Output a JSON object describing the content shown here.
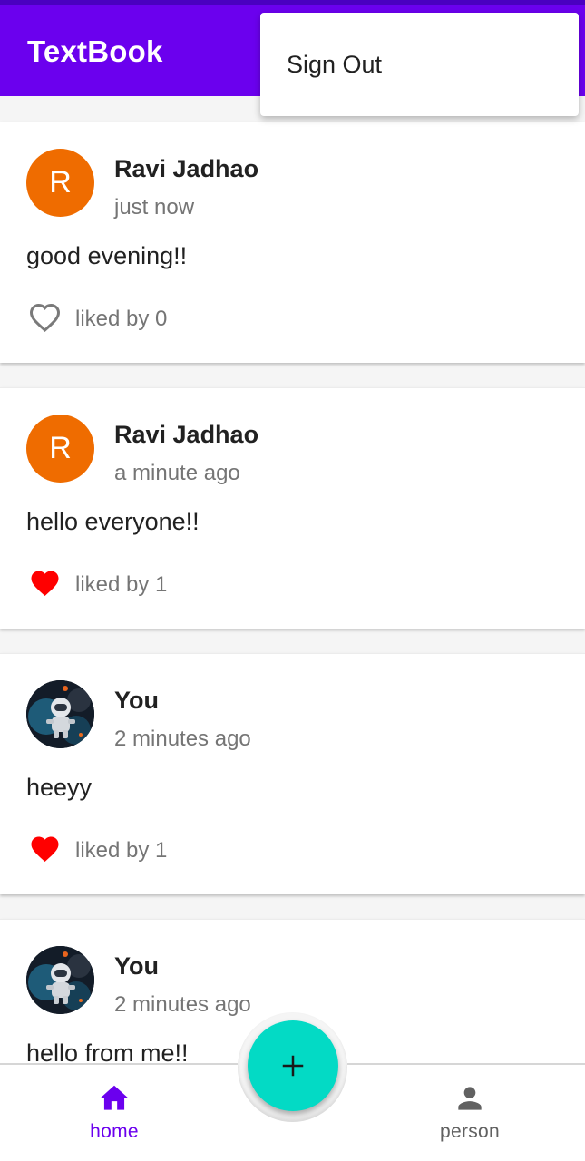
{
  "app_bar": {
    "title": "TextBook",
    "background": "#6b00ee"
  },
  "overflow_menu": {
    "items": [
      {
        "label": "Sign Out"
      }
    ]
  },
  "posts": [
    {
      "author": "Ravi Jadhao",
      "avatar_type": "letter",
      "avatar_letter": "R",
      "avatar_color": "#ef6c00",
      "time": "just now",
      "text": "good evening!!",
      "liked": false,
      "like_icon": "heart-outline-icon",
      "likes_label": "liked by 0"
    },
    {
      "author": "Ravi Jadhao",
      "avatar_type": "letter",
      "avatar_letter": "R",
      "avatar_color": "#ef6c00",
      "time": "a minute ago",
      "text": "hello everyone!!",
      "liked": true,
      "like_icon": "heart-filled-icon",
      "likes_label": "liked by 1"
    },
    {
      "author": "You",
      "avatar_type": "photo",
      "avatar_icon": "astronaut-photo",
      "time": "2 minutes ago",
      "text": "heeyy",
      "liked": true,
      "like_icon": "heart-filled-icon",
      "likes_label": "liked by 1"
    },
    {
      "author": "You",
      "avatar_type": "photo",
      "avatar_icon": "astronaut-photo",
      "time": "2 minutes ago",
      "text": "hello from me!!",
      "liked": false,
      "like_icon": "heart-outline-icon",
      "likes_label": ""
    }
  ],
  "fab": {
    "icon": "plus-icon",
    "color": "#03dac5"
  },
  "bottom_nav": {
    "items": [
      {
        "label": "home",
        "icon": "home-icon",
        "selected": true
      },
      {
        "label": "person",
        "icon": "person-icon",
        "selected": false
      }
    ],
    "active_color": "#6b00ee",
    "inactive_color": "#616161"
  },
  "like_color": "#ff0000"
}
